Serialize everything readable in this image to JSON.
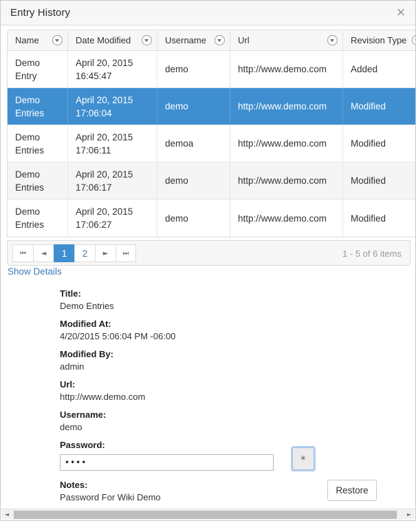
{
  "window": {
    "title": "Entry History",
    "close_label": "×"
  },
  "grid": {
    "columns": [
      {
        "label": "Name",
        "filter_icon": "filter-dropdown-icon"
      },
      {
        "label": "Date Modified",
        "filter_icon": "filter-dropdown-icon"
      },
      {
        "label": "Username",
        "filter_icon": "filter-dropdown-icon"
      },
      {
        "label": "Url",
        "filter_icon": "filter-dropdown-icon"
      },
      {
        "label": "Revision Type",
        "filter_icon": "filter-dropdown-icon"
      },
      {
        "label": "",
        "filter_icon": "filter-dropdown-icon"
      }
    ],
    "rows": [
      {
        "name": "Demo Entry",
        "date_modified": "April 20, 2015 16:45:47",
        "username": "demo",
        "url": "http://www.demo.com",
        "revision_type": "Added",
        "selected": false,
        "alt": false
      },
      {
        "name": "Demo Entries",
        "date_modified": "April 20, 2015 17:06:04",
        "username": "demo",
        "url": "http://www.demo.com",
        "revision_type": "Modified",
        "selected": true,
        "alt": false
      },
      {
        "name": "Demo Entries",
        "date_modified": "April 20, 2015 17:06:11",
        "username": "demoa",
        "url": "http://www.demo.com",
        "revision_type": "Modified",
        "selected": false,
        "alt": false
      },
      {
        "name": "Demo Entries",
        "date_modified": "April 20, 2015 17:06:17",
        "username": "demo",
        "url": "http://www.demo.com",
        "revision_type": "Modified",
        "selected": false,
        "alt": true
      },
      {
        "name": "Demo Entries",
        "date_modified": "April 20, 2015 17:06:27",
        "username": "demo",
        "url": "http://www.demo.com",
        "revision_type": "Modified",
        "selected": false,
        "alt": false
      }
    ]
  },
  "pager": {
    "first_label": "⏮",
    "prev_label": "◄",
    "page1_label": "1",
    "page2_label": "2",
    "next_label": "►",
    "last_label": "⏭",
    "info": "1 - 5 of 6 items",
    "active_page": "1"
  },
  "links": {
    "show_details": "Show Details"
  },
  "details": {
    "title_label": "Title:",
    "title_value": "Demo Entries",
    "modified_at_label": "Modified At:",
    "modified_at_value": "4/20/2015 5:06:04 PM -06:00",
    "modified_by_label": "Modified By:",
    "modified_by_value": "admin",
    "url_label": "Url:",
    "url_value": "http://www.demo.com",
    "username_label": "Username:",
    "username_value": "demo",
    "password_label": "Password:",
    "password_value": "••••",
    "password_toggle_label": "✳",
    "notes_label": "Notes:",
    "notes_value": "Password For Wiki Demo"
  },
  "actions": {
    "restore_label": "Restore"
  },
  "scrollbar": {
    "left_arrow": "◄",
    "right_arrow": "►"
  },
  "colors": {
    "selection_blue": "#3f8fd0",
    "link_blue": "#3d7eb8",
    "alt_row": "#f5f5f5",
    "header_bg": "#f7f7f7",
    "border": "#dcdcdc"
  }
}
